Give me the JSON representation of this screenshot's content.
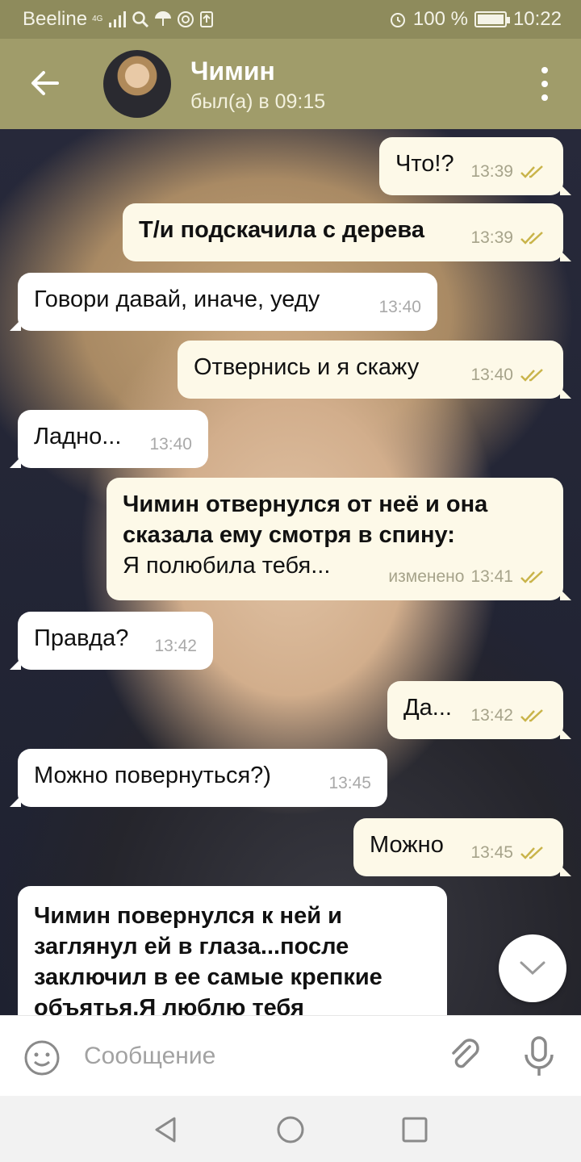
{
  "status_bar": {
    "carrier": "Beeline",
    "network": "4G",
    "battery": "100 %",
    "battery_level": 1.0,
    "time": "10:22",
    "icons": [
      "signal-icon",
      "search-icon",
      "umbrella-icon",
      "at-icon",
      "upload-icon",
      "alarm-icon",
      "battery-icon"
    ]
  },
  "header": {
    "title": "Чимин",
    "status": "был(а) в 09:15",
    "back_icon": "arrow-left-icon",
    "menu_icon": "more-vertical-icon"
  },
  "messages": [
    {
      "dir": "out",
      "bold": false,
      "text": "Что!?",
      "time": "13:39",
      "edited": "",
      "read": true
    },
    {
      "dir": "out",
      "bold": true,
      "text": "Т/и подскачила с дерева",
      "time": "13:39",
      "edited": "",
      "read": true
    },
    {
      "dir": "in",
      "bold": false,
      "text": "Говори давай, иначе, уеду",
      "time": "13:40",
      "edited": "",
      "read": false
    },
    {
      "dir": "out",
      "bold": false,
      "text": "Отвернись и я скажу",
      "time": "13:40",
      "edited": "",
      "read": true
    },
    {
      "dir": "in",
      "bold": false,
      "text": "Ладно...",
      "time": "13:40",
      "edited": "",
      "read": false
    },
    {
      "dir": "out",
      "bold": true,
      "text": "Чимин отвернулся от неё и она сказала ему смотря в спину:",
      "text2": "Я полюбила тебя...",
      "time": "13:41",
      "edited": "изменено",
      "read": true
    },
    {
      "dir": "in",
      "bold": false,
      "text": "Правда?",
      "time": "13:42",
      "edited": "",
      "read": false
    },
    {
      "dir": "out",
      "bold": false,
      "text": "Да...",
      "time": "13:42",
      "edited": "",
      "read": true
    },
    {
      "dir": "in",
      "bold": false,
      "text": "Можно повернуться?)",
      "time": "13:45",
      "edited": "",
      "read": false
    },
    {
      "dir": "out",
      "bold": false,
      "text": "Можно",
      "time": "13:45",
      "edited": "",
      "read": true
    },
    {
      "dir": "in",
      "bold": true,
      "text": "Чимин повернулся к ней и заглянул ей в глаза...после заключил в ее самые крепкие объятья.Я люблю тебя",
      "time": "",
      "edited": "",
      "read": false
    }
  ],
  "input": {
    "placeholder": "Сообщение",
    "value": ""
  },
  "colors": {
    "header": "#a09c6a",
    "status_bar": "#8e8b5c",
    "outgoing_bubble": "#fdf9e8",
    "incoming_bubble": "#ffffff",
    "read_ticks": "#c9b44a"
  }
}
